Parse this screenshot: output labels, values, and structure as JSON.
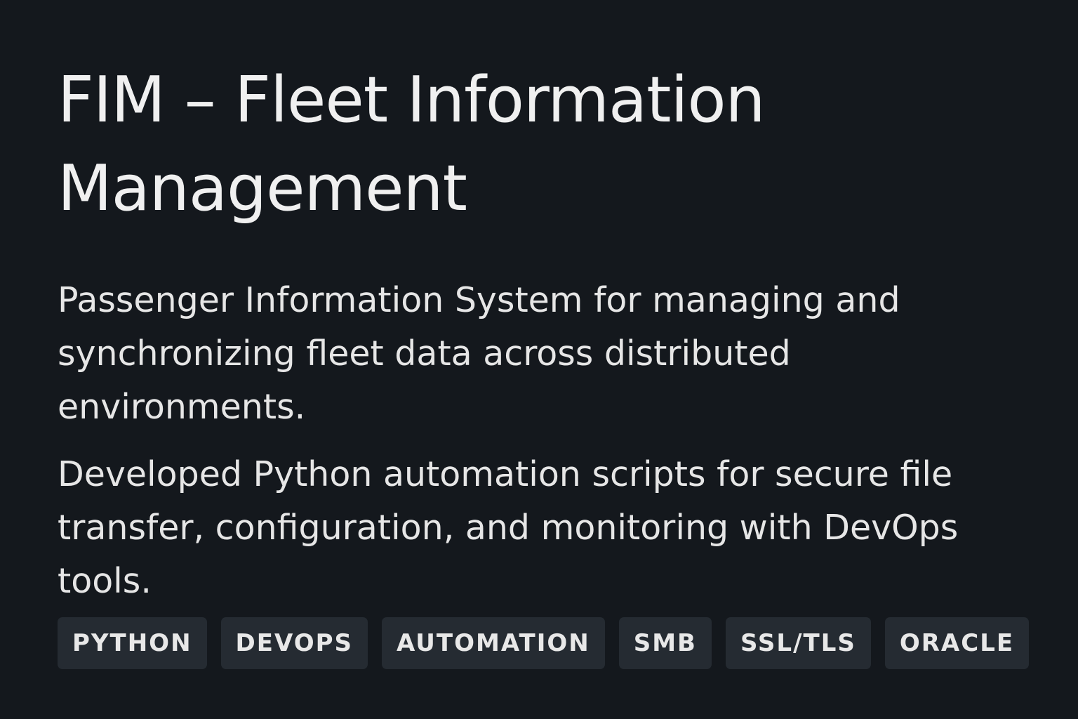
{
  "project": {
    "title": "FIM – Fleet Information Management",
    "description_1": "Passenger Information System for managing and synchronizing fleet data across distributed environments.",
    "description_2": "Developed Python automation scripts for secure file transfer, configuration, and monitoring with DevOps tools."
  },
  "tags": [
    {
      "label": "PYTHON"
    },
    {
      "label": "DEVOPS"
    },
    {
      "label": "AUTOMATION"
    },
    {
      "label": "SMB"
    },
    {
      "label": "SSL/TLS"
    },
    {
      "label": "ORACLE"
    }
  ]
}
